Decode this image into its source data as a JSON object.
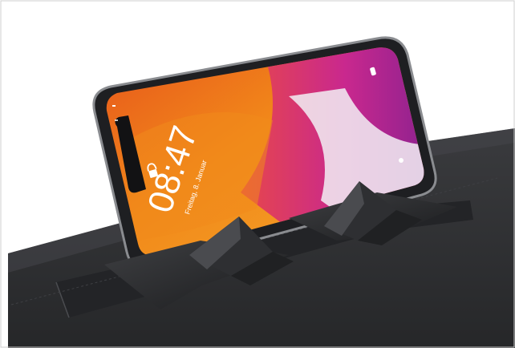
{
  "photo": {
    "subject": "Smartphone on folding stand over dark felt mat",
    "lock_screen": {
      "time": "08:47",
      "date": "Freitag, 8. Januar"
    },
    "colors": {
      "mat": "#2f3033",
      "wallpaper_orange": "#f07a16",
      "wallpaper_red": "#e8473a",
      "wallpaper_purple": "#a1279a",
      "phone_frame": "#1e1f22"
    }
  }
}
